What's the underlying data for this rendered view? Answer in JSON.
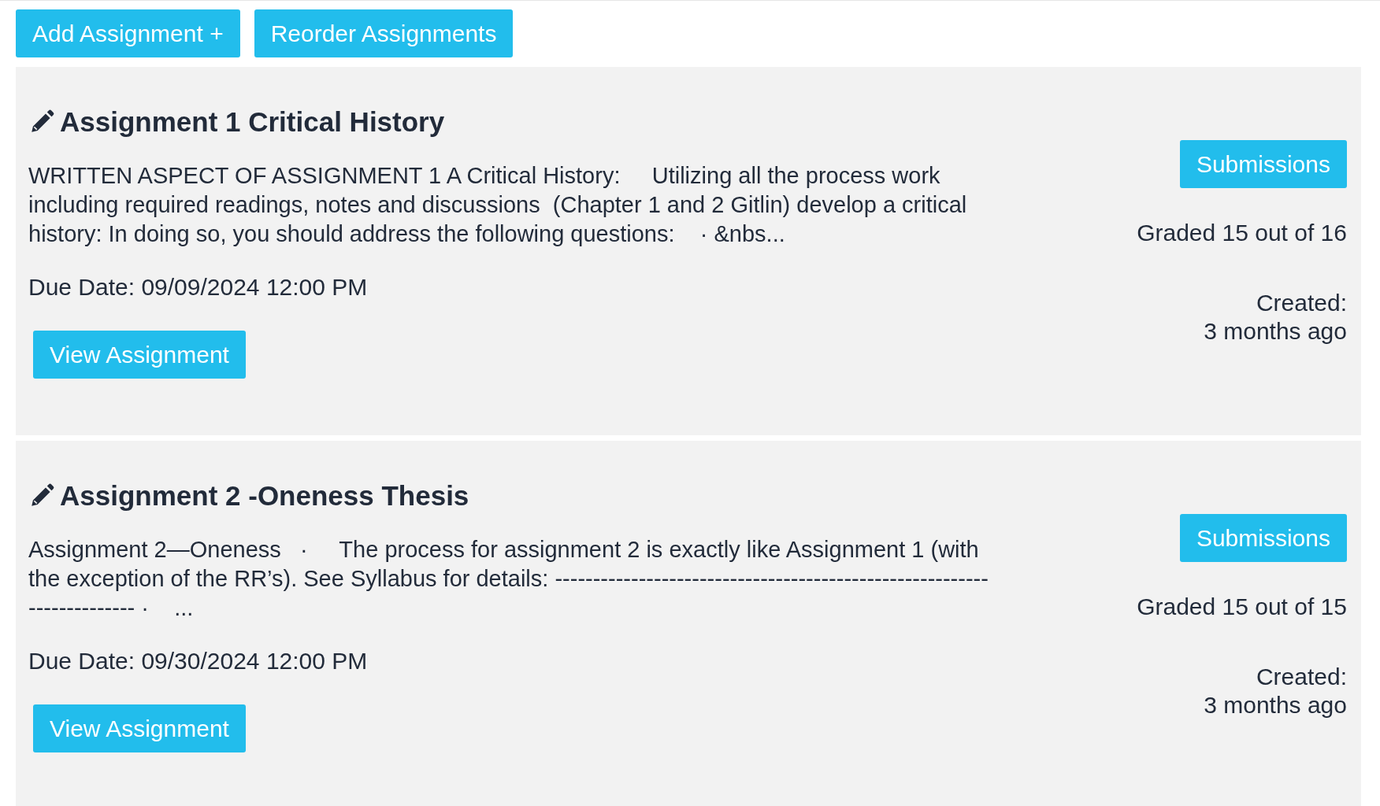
{
  "toolbar": {
    "buttons": [
      "Add Assignment +",
      "Reorder Assignments"
    ]
  },
  "assignments": [
    {
      "title": "Assignment 1 Critical History",
      "description": "WRITTEN ASPECT OF ASSIGNMENT 1 A Critical History:     Utilizing all the process work including required readings, notes and discussions  (Chapter 1 and 2 Gitlin) develop a critical history: In doing so, you should address the following questions:    · &nbs...",
      "due": "Due Date: 09/09/2024 12:00 PM",
      "view_button": "View Assignment",
      "submissions_button": "Submissions",
      "graded": "Graded 15 out of 16",
      "created_label": "Created:",
      "created_value": "3 months ago"
    },
    {
      "title": "Assignment 2 -Oneness Thesis",
      "description": "Assignment 2—Oneness   ·     The process for assignment 2 is exactly like Assignment 1 (with the exception of the RR’s). See Syllabus for details: ----------------------------------------------------------------------- ·    ...",
      "due": "Due Date: 09/30/2024 12:00 PM",
      "view_button": "View Assignment",
      "submissions_button": "Submissions",
      "graded": "Graded 15 out of 15",
      "created_label": "Created:",
      "created_value": "3 months ago"
    }
  ]
}
